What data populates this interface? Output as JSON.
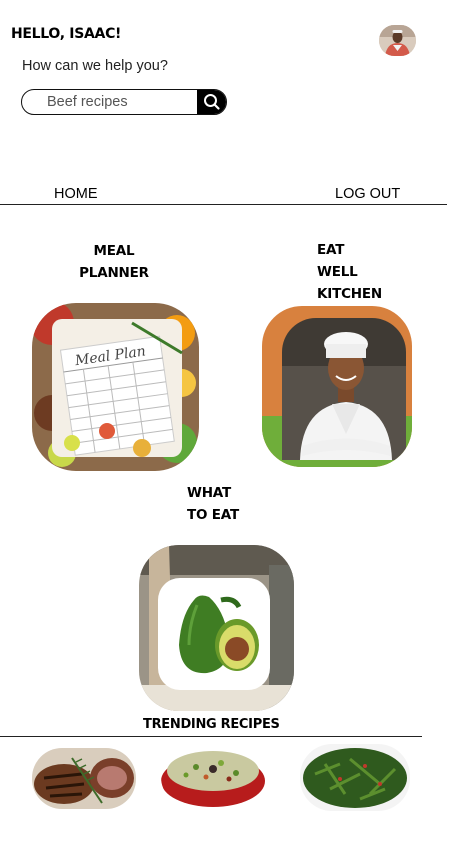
{
  "header": {
    "greeting": "HELLO, ISAAC!",
    "help_text": "How can we help you?"
  },
  "search": {
    "value": "Beef recipes",
    "button_icon": "search-icon"
  },
  "nav": {
    "home": "HOME",
    "logout": "LOG OUT"
  },
  "cards": {
    "meal_planner_line1": "MEAL",
    "meal_planner_line2": "PLANNER",
    "meal_plan_image_text": "Meal Plan",
    "eat_well_line1": "EAT WELL",
    "eat_well_line2": "KITCHEN",
    "what_to_eat_line1": "WHAT",
    "what_to_eat_line2": "TO EAT"
  },
  "trending": {
    "title": "TRENDING RECIPES"
  }
}
